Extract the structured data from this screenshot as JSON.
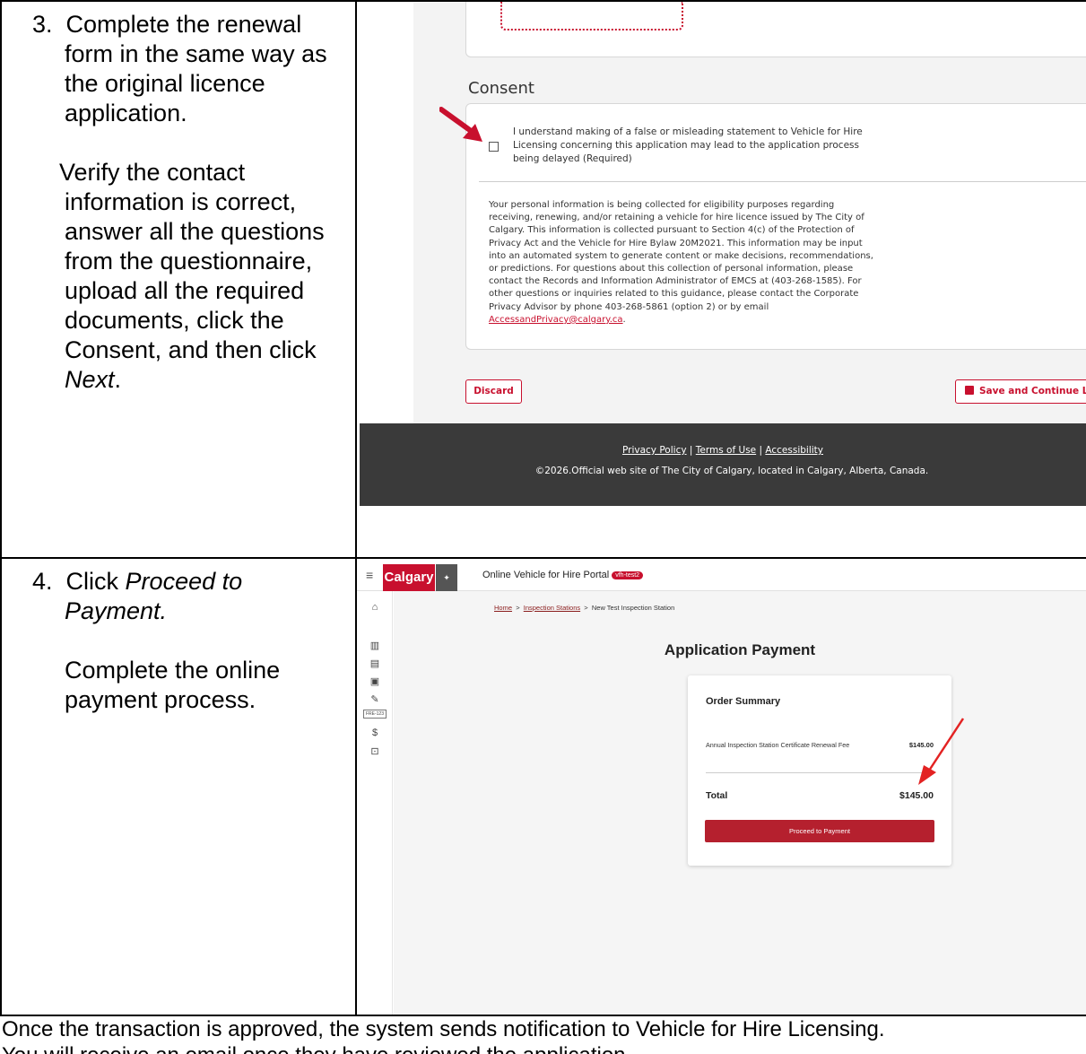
{
  "steps": [
    {
      "number": "3.",
      "title_lines": [
        "Complete the renewal",
        "form in the same way as",
        "the original licence",
        "application."
      ],
      "detail_lines": [
        "Verify the contact",
        "information is correct,",
        "answer all the questions",
        "from the questionnaire,",
        "upload all the required",
        "documents, click the",
        "Consent, and then click"
      ],
      "detail_emph": "Next",
      "detail_end": "."
    },
    {
      "number": "4.",
      "title_prefix": "Click ",
      "title_emph_lines": [
        "Proceed to",
        "Payment."
      ],
      "detail_lines": [
        "Complete the online",
        "payment process."
      ]
    }
  ],
  "consent_screen": {
    "section_title": "Consent",
    "consent_statement_lines": [
      "I understand making of a false or misleading statement to Vehicle for Hire",
      "Licensing concerning this application may lead to the application process",
      "being delayed (Required)"
    ],
    "privacy_lines": [
      "Your personal information is being collected for eligibility purposes regarding",
      "receiving, renewing, and/or retaining a vehicle for hire licence issued by The City of",
      "Calgary. This information is collected pursuant to Section 4(c) of the Protection of",
      "Privacy Act and the Vehicle for Hire Bylaw 20M2021. This information may be input",
      "into an automated system to generate content or make decisions, recommendations,",
      "or predictions. For questions about this collection of personal information, please",
      "contact the Records and Information Administrator of EMCS at (403-268-1585). For",
      "other questions or inquiries related to this guidance, please contact the Corporate",
      "Privacy Advisor by phone 403-268-5861 (option 2) or by email"
    ],
    "privacy_email": "AccessandPrivacy@calgary.ca",
    "privacy_email_end": ".",
    "discard_label": "Discard",
    "save_label": "Save and Continue Late",
    "footer": {
      "privacy_policy": "Privacy Policy",
      "terms_of_use": "Terms of Use",
      "accessibility": "Accessibility",
      "separator": "|",
      "copyright": "©2026.Official web site of The City of Calgary, located in Calgary, Alberta, Canada."
    },
    "accent_color": "#c8102e"
  },
  "payment_screen": {
    "logo_text": "Calgary",
    "portal_title": "Online Vehicle for Hire Portal",
    "env_badge": "vfh-test2",
    "breadcrumb": {
      "home": "Home",
      "sep": ">",
      "inspection_stations": "Inspection Stations",
      "current": "New Test Inspection Station"
    },
    "page_title": "Application Payment",
    "order_summary_title": "Order Summary",
    "line_item": "Annual Inspection Station Certificate Renewal Fee",
    "line_item_price": "$145.00",
    "total_label": "Total",
    "total_value": "$145.00",
    "pay_button": "Proceed to Payment",
    "sidebar_icons": [
      "home-icon",
      "building-icon",
      "car-icon",
      "vehicle-icon",
      "wrench-icon",
      "plate-icon",
      "dollar-icon",
      "lock-icon"
    ],
    "plate_text": "FRE-123",
    "dollar_symbol": "$"
  },
  "closing_note_lines": [
    "Once the transaction is approved, the system sends notification to Vehicle for Hire Licensing.",
    "You will receive an email once they have reviewed the application."
  ]
}
